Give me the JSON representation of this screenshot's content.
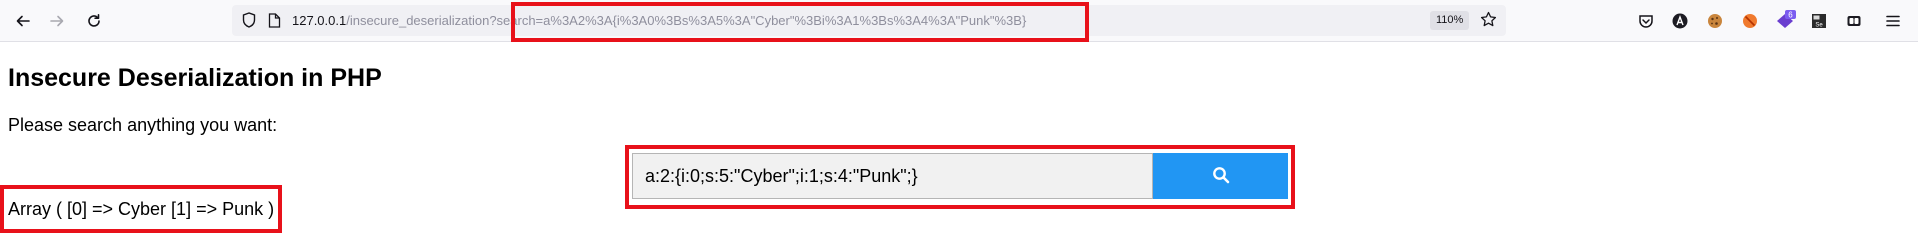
{
  "browser": {
    "url_host": "127.0.0.1",
    "url_path": "/insecure_deserialization",
    "url_query": "?search=a%3A2%3A{i%3A0%3Bs%3A5%3A\"Cyber\"%3Bi%3A1%3Bs%3A4%3A\"Punk\"%3B}",
    "zoom": "110%",
    "extension_badge": "6",
    "icons": [
      "back-arrow-icon",
      "forward-arrow-icon",
      "reload-icon",
      "shield-icon",
      "page-icon",
      "star-icon",
      "pocket-icon",
      "account-icon",
      "cookie-icon",
      "blocker-icon",
      "notification-icon",
      "selenium-icon",
      "container-icon",
      "menu-icon"
    ]
  },
  "page": {
    "title": "Insecure Deserialization in PHP",
    "prompt": "Please search anything you want:",
    "search_value": "a:2:{i:0;s:5:\"Cyber\";i:1;s:4:\"Punk\";}",
    "output": "Array ( [0] => Cyber [1] => Punk )"
  },
  "colors": {
    "highlight": "#e8111a",
    "button": "#2196f3"
  }
}
